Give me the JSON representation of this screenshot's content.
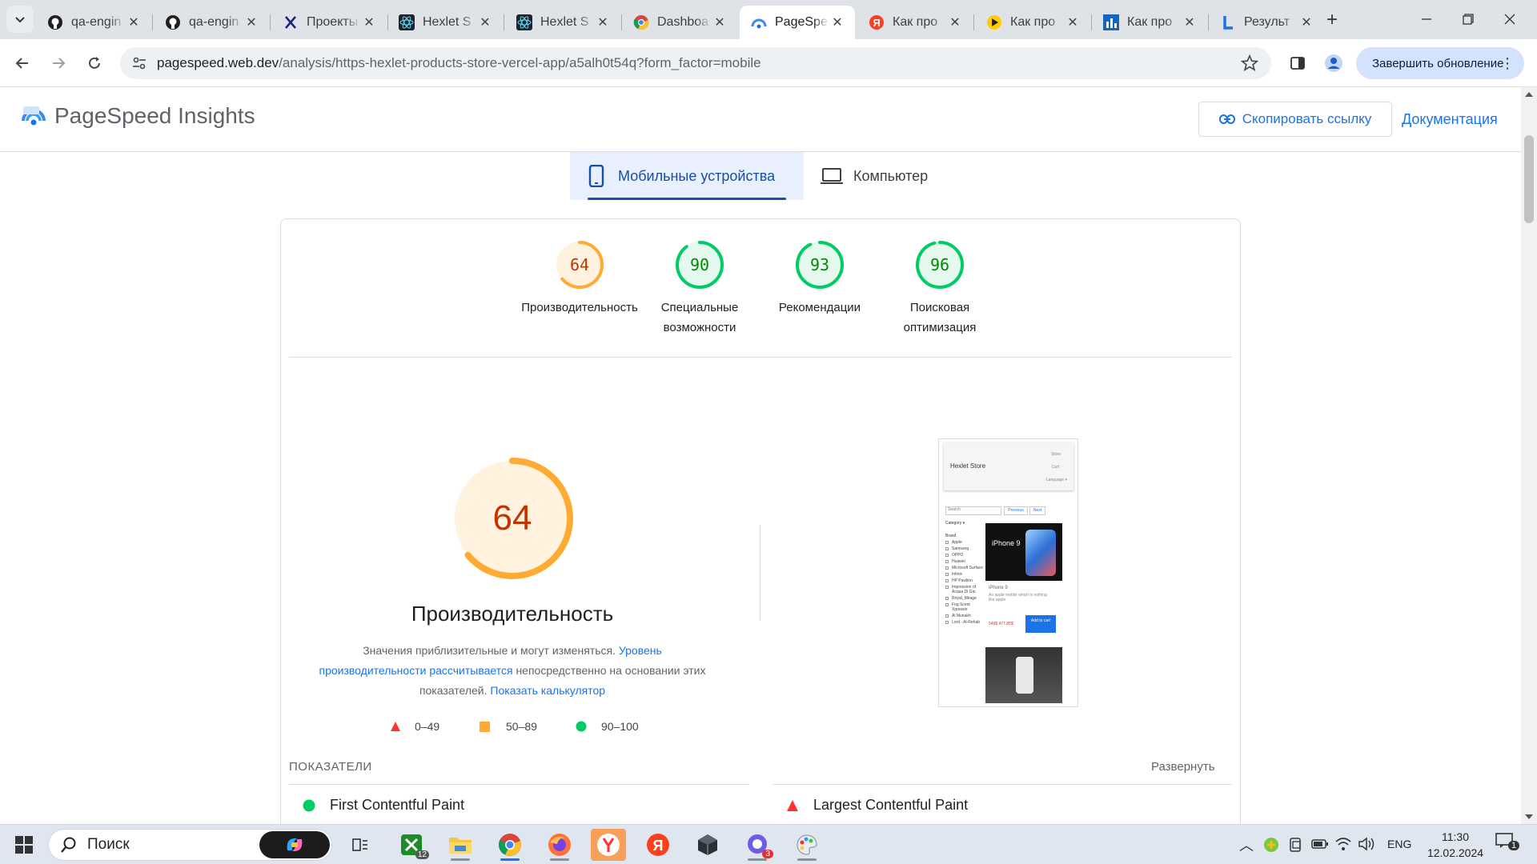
{
  "browser": {
    "tabs": [
      {
        "title": "qa-engin",
        "icon": "github-icon",
        "active": false
      },
      {
        "title": "qa-engin",
        "icon": "github-icon",
        "active": false
      },
      {
        "title": "Проекты",
        "icon": "x-logo-icon",
        "active": false
      },
      {
        "title": "Hexlet S",
        "icon": "react-icon",
        "active": false
      },
      {
        "title": "Hexlet S",
        "icon": "react-icon",
        "active": false
      },
      {
        "title": "Dashboa",
        "icon": "chrome-icon",
        "active": false
      },
      {
        "title": "PageSpe",
        "icon": "pagespeed-icon",
        "active": true
      },
      {
        "title": "Как про",
        "icon": "yandex-icon",
        "active": false
      },
      {
        "title": "Как про",
        "icon": "play-icon",
        "active": false
      },
      {
        "title": "Как про",
        "icon": "chart-icon",
        "active": false
      },
      {
        "title": "Результ",
        "icon": "l-logo-icon",
        "active": false
      }
    ],
    "url_host": "pagespeed.web.dev",
    "url_path": "/analysis/https-hexlet-products-store-vercel-app/a5alh0t54q?form_factor=mobile",
    "update_button": "Завершить обновление"
  },
  "psi": {
    "brand": "PageSpeed Insights",
    "copy_link": "Скопировать ссылку",
    "docs": "Документация",
    "device_tabs": {
      "mobile": "Мобильные устройства",
      "desktop": "Компьютер"
    },
    "scores": [
      {
        "value": "64",
        "label": "Производительность",
        "label2": "",
        "color": "#fa3",
        "bg": "#fff3e0",
        "text": "#c33300",
        "frac": 0.64
      },
      {
        "value": "90",
        "label": "Специальные",
        "label2": "возможности",
        "color": "#0c6",
        "bg": "#e6f9ee",
        "text": "#008800",
        "frac": 0.9
      },
      {
        "value": "93",
        "label": "Рекомендации",
        "label2": "",
        "color": "#0c6",
        "bg": "#e6f9ee",
        "text": "#008800",
        "frac": 0.93
      },
      {
        "value": "96",
        "label": "Поисковая",
        "label2": "оптимизация",
        "color": "#0c6",
        "bg": "#e6f9ee",
        "text": "#008800",
        "frac": 0.96
      }
    ],
    "perf": {
      "score": "64",
      "title": "Производительность",
      "desc_1": "Значения приблизительные и могут изменяться.",
      "desc_link_1": "Уровень производительности рассчитывается",
      "desc_2": "непосредственно на основании этих показателей.",
      "desc_link_2": "Показать калькулятор"
    },
    "legend": [
      {
        "range": "0–49",
        "color": "#f33"
      },
      {
        "range": "50–89",
        "color": "#fa3"
      },
      {
        "range": "90–100",
        "color": "#0c6"
      }
    ],
    "metrics_header": "ПОКАЗАТЕЛИ",
    "expand": "Развернуть",
    "metrics": [
      {
        "name": "First Contentful Paint",
        "status": "good"
      },
      {
        "name": "Largest Contentful Paint",
        "status": "poor"
      }
    ],
    "screenshot": {
      "store_title": "Hexlet Store",
      "nav": [
        "Store",
        "Cart",
        "Language ▾"
      ],
      "search": "Search",
      "prev": "Previous",
      "next": "Next",
      "category": "Category ▾",
      "brand_label": "Brand",
      "brands": [
        "Apple",
        "Samsung",
        "OPPO",
        "Huawei",
        "Microsoft Surface",
        "Infinix",
        "HP Pavilion",
        "Impression of Acqua Di Gio",
        "Royal_Mirage",
        "Fog Scent Xpressio",
        "Al Munakh",
        "Lord - Al-Rehab"
      ],
      "product_name": "iPhone 9",
      "product_desc": "An apple mobile which is nothing like apple",
      "price": "549$ 477.85$",
      "add_to_cart": "Add to cart",
      "promo": "iPhone 9"
    }
  },
  "taskbar": {
    "search": "Поиск",
    "time": "11:30",
    "date": "12.02.2024",
    "lang": "ENG",
    "xbox_badge": "12",
    "viber_badge": "3",
    "notif_count": "1"
  }
}
